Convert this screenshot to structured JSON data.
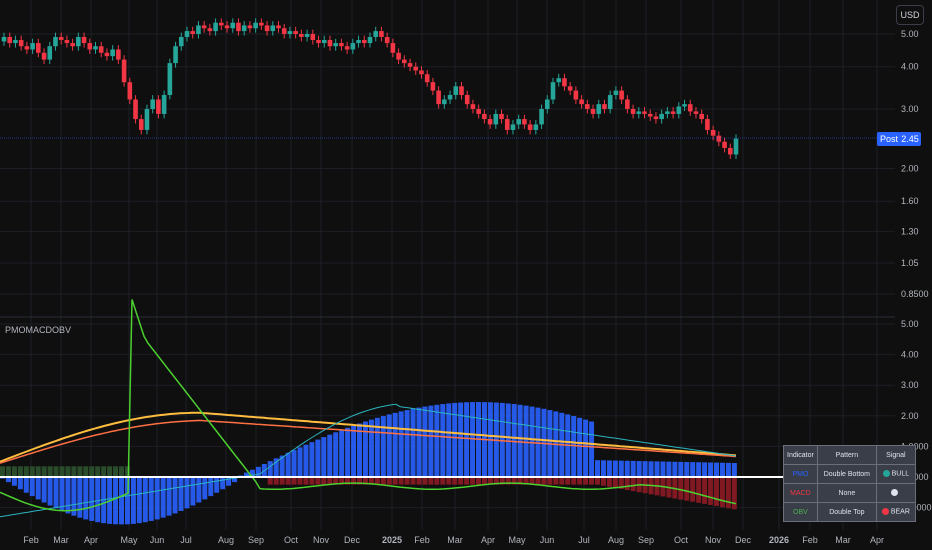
{
  "currency": "USD",
  "post_label": "Post",
  "post_price": "2.45",
  "indicator_title": "PMOMACDOBV",
  "price_axis": [
    "5.00",
    "4.00",
    "3.00",
    "2.00",
    "1.60",
    "1.30",
    "1.05",
    "0.8500"
  ],
  "indicator_axis": [
    "5.00",
    "4.00",
    "3.00",
    "2.00",
    "1.0000",
    "0.0000",
    "-1.0000"
  ],
  "time_axis": [
    "Feb",
    "Mar",
    "Apr",
    "May",
    "Jun",
    "Jul",
    "Aug",
    "Sep",
    "Oct",
    "Nov",
    "Dec",
    "2025",
    "Feb",
    "Mar",
    "Apr",
    "May",
    "Jun",
    "Jul",
    "Aug",
    "Sep",
    "Oct",
    "Nov",
    "Dec",
    "2026",
    "Feb",
    "Mar",
    "Apr"
  ],
  "signal_table": {
    "headers": [
      "Indicator",
      "Pattern",
      "Signal"
    ],
    "rows": [
      {
        "indicator": "PMO",
        "pattern": "Double Bottom",
        "signal": "BULL",
        "color": "#2962ff",
        "dot": "#26a69a"
      },
      {
        "indicator": "MACD",
        "pattern": "None",
        "signal": "",
        "color": "#f23645",
        "dot": "#e0e3eb"
      },
      {
        "indicator": "OBV",
        "pattern": "Double Top",
        "signal": "BEAR",
        "color": "#4caf50",
        "dot": "#f23645"
      }
    ]
  },
  "colors": {
    "up": "#26a69a",
    "down": "#f23645",
    "hist_pos": "#2962ff",
    "hist_neg": "#801922",
    "hist_pos_dim": "#2b4c2b",
    "obv": "#4cd130",
    "pmo": "#ffbd3f",
    "signal": "#ff7043",
    "teal": "#2bb5c0",
    "zero": "#ffffff"
  }
}
